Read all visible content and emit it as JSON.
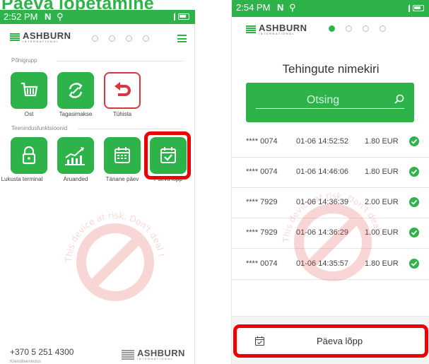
{
  "headline": "Päeva lõpetamine",
  "left": {
    "status_time": "2:52 PM",
    "brand": "ASHBURN",
    "brand_sub": "INTERNATIONAL",
    "section_main": "Põhigrupp",
    "section_service": "Teenindusfunktsioonid",
    "tiles_main": [
      {
        "label": "Ost",
        "icon": "cart-icon"
      },
      {
        "label": "Tagasimakse",
        "icon": "refresh-icon"
      },
      {
        "label": "Tühista",
        "icon": "undo-icon"
      }
    ],
    "tiles_service": [
      {
        "label": "Lukusta terminal",
        "icon": "lock-icon"
      },
      {
        "label": "Aruanded",
        "icon": "chart-icon"
      },
      {
        "label": "Tänane päev",
        "icon": "calendar-grid-icon"
      },
      {
        "label": "Päeva lõpp",
        "icon": "calendar-check-icon"
      }
    ],
    "footer_phone": "+370 5 251 4300",
    "footer_sub": "Klienditeenindus"
  },
  "right": {
    "status_time": "2:54 PM",
    "brand": "ASHBURN",
    "brand_sub": "INTERNATIONAL",
    "title": "Tehingute nimekiri",
    "search_placeholder": "Otsing",
    "transactions": [
      {
        "card": "**** 0074",
        "datetime": "01-06 14:52:52",
        "amount": "1.80 EUR"
      },
      {
        "card": "**** 0074",
        "datetime": "01-06 14:46:06",
        "amount": "1.80 EUR"
      },
      {
        "card": "**** 7929",
        "datetime": "01-06 14:36:39",
        "amount": "2.00 EUR"
      },
      {
        "card": "**** 7929",
        "datetime": "01-06 14:36:29",
        "amount": "1.00 EUR"
      },
      {
        "card": "**** 0074",
        "datetime": "01-06 14:35:57",
        "amount": "1.80 EUR"
      }
    ],
    "bottom_action": "Päeva lõpp"
  },
  "watermark_text": "This device at risk. Don't deal !",
  "colors": {
    "brand_green": "#2db34a",
    "highlight_red": "#ec0000",
    "undo_red": "#d93640"
  }
}
